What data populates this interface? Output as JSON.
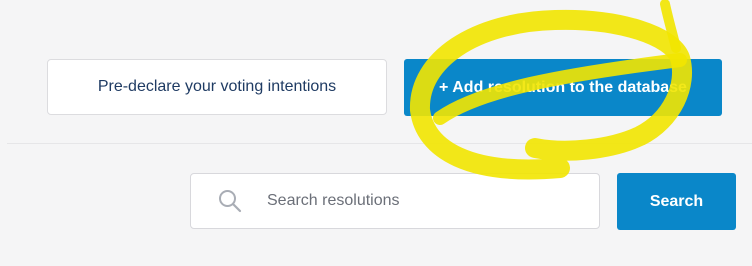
{
  "actions": {
    "predeclare_label": "Pre-declare your voting intentions",
    "add_resolution_label": "+ Add resolution to the database"
  },
  "search": {
    "placeholder": "Search resolutions",
    "value": "",
    "button_label": "Search",
    "icon": "search-icon"
  },
  "colors": {
    "primary": "#0a87c9",
    "outline_text": "#1f3b63",
    "annotation_highlight": "#f2e600"
  }
}
